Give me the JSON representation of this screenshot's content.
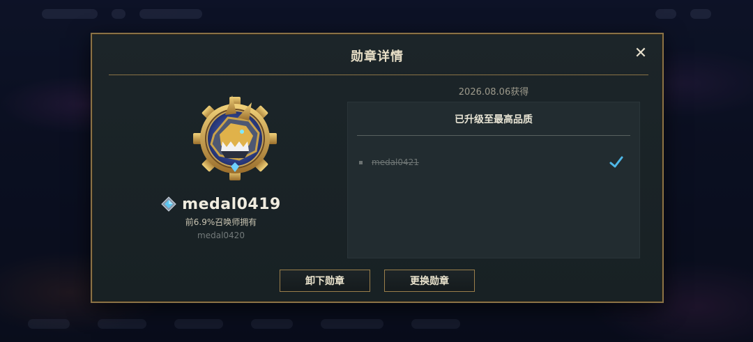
{
  "dialog": {
    "title": "勋章详情",
    "close_icon": "close-icon"
  },
  "medal": {
    "name": "medal0419",
    "owned_text": "前6.9%召唤师拥有",
    "sub_name": "medal0420",
    "emblem_icon": "medal-emblem-icon",
    "rank_icon": "diamond-rank-icon"
  },
  "details": {
    "date_obtained": "2026.08.06获得",
    "panel_title": "已升级至最高品质",
    "items": [
      {
        "label": "medal0421",
        "completed": true
      }
    ]
  },
  "buttons": {
    "unequip": "卸下勋章",
    "change": "更换勋章"
  },
  "colors": {
    "border_gold": "#8a7246",
    "check_blue": "#4fb8e8",
    "modal_bg": "#1c2529"
  }
}
